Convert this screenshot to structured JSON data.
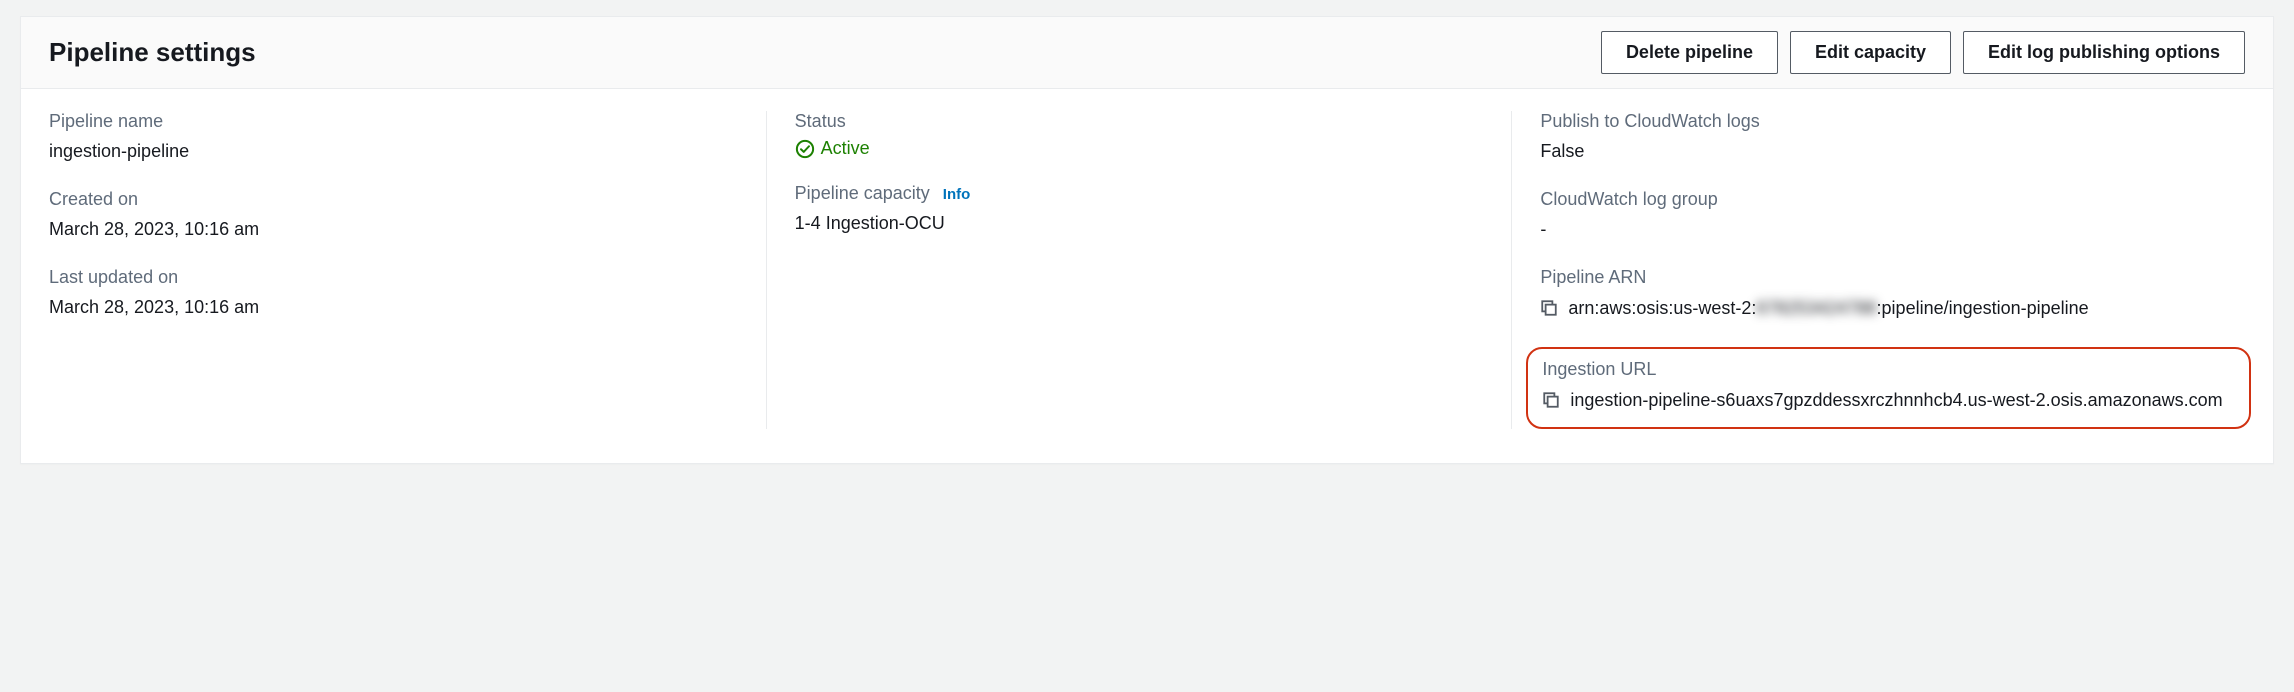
{
  "header": {
    "title": "Pipeline settings",
    "buttons": {
      "delete": "Delete pipeline",
      "edit_capacity": "Edit capacity",
      "edit_logs": "Edit log publishing options"
    }
  },
  "left": {
    "name_label": "Pipeline name",
    "name_value": "ingestion-pipeline",
    "created_label": "Created on",
    "created_value": "March 28, 2023, 10:16 am",
    "updated_label": "Last updated on",
    "updated_value": "March 28, 2023, 10:16 am"
  },
  "middle": {
    "status_label": "Status",
    "status_value": "Active",
    "capacity_label": "Pipeline capacity",
    "info_text": "Info",
    "capacity_value": "1-4 Ingestion-OCU"
  },
  "right": {
    "cw_publish_label": "Publish to CloudWatch logs",
    "cw_publish_value": "False",
    "cw_group_label": "CloudWatch log group",
    "cw_group_value": "-",
    "arn_label": "Pipeline ARN",
    "arn_prefix": "arn:aws:osis:us-west-2:",
    "arn_redacted": "678253424788",
    "arn_suffix": ":pipeline/ingestion-pipeline",
    "url_label": "Ingestion URL",
    "url_value": "ingestion-pipeline-s6uaxs7gpzddessxrczhnnhcb4.us-west-2.osis.amazonaws.com"
  }
}
